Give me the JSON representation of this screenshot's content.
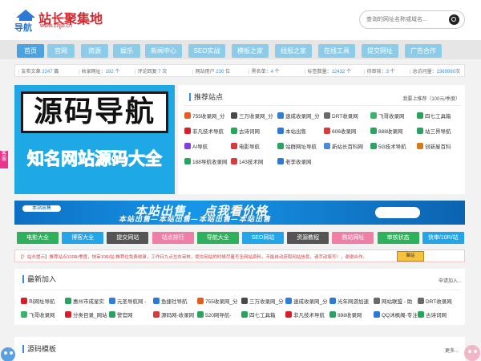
{
  "header": {
    "logo_main": "站长聚集地",
    "logo_nav": "导航",
    "logo_url": "www.zzjjd.cn",
    "search_placeholder": "查询的网址名称或域名..."
  },
  "nav": [
    "首页",
    "官网",
    "资源",
    "娱乐",
    "新闻中心",
    "SEO实战",
    "模板之家",
    "线报之家",
    "在线工具",
    "提交网址",
    "广告合作"
  ],
  "stats": [
    {
      "label": "友布文章",
      "value": "2247",
      "unit": "篇"
    },
    {
      "label": "收录网址：",
      "value": "192",
      "unit": "个"
    },
    {
      "label": "评论回复",
      "value": "7",
      "unit": "次"
    },
    {
      "label": "网站用户",
      "value": "230",
      "unit": "位"
    },
    {
      "label": "黑名单：",
      "value": "4",
      "unit": "个"
    },
    {
      "label": "标签数量：",
      "value": "12432",
      "unit": "个"
    },
    {
      "label": "待审核：",
      "value": "3",
      "unit": "个"
    },
    {
      "label": "总访问量：",
      "value": "2369990",
      "unit": "次"
    }
  ],
  "banner": {
    "title": "源码导航",
    "subtitle": "知名网站源码大全"
  },
  "recommend": {
    "title": "推荐站点",
    "more": "我要上推荐（100元/季度）",
    "sites": [
      {
        "name": "755收录网_分",
        "color": "#e85b1c"
      },
      {
        "name": "三万收录网_分",
        "color": "#4a4a4a"
      },
      {
        "name": "速成收录网_分",
        "color": "#2f7fd6"
      },
      {
        "name": "DRT收录网",
        "color": "#6a6a6a"
      },
      {
        "name": "飞哥收录网",
        "color": "#3bb36a"
      },
      {
        "name": "四七工具箱",
        "color": "#29a35a"
      },
      {
        "name": "非凡技术导航",
        "color": "#d61f26"
      },
      {
        "name": "古诗词网",
        "color": "#26a65b"
      },
      {
        "name": "本站出售",
        "color": "#2b7ad6"
      },
      {
        "name": "606收录网",
        "color": "#d63c3c"
      },
      {
        "name": "888收录网",
        "color": "#2aa361"
      },
      {
        "name": "站三界导航",
        "color": "#2aa361"
      },
      {
        "name": "AI导航",
        "color": "#8a3ad6"
      },
      {
        "name": "电影导航",
        "color": "#d63c3c"
      },
      {
        "name": "站群网址导航",
        "color": "#2aa361"
      },
      {
        "name": "新站长百科网",
        "color": "#4a8ad6"
      },
      {
        "name": "5G技术导航",
        "color": "#2aa361"
      },
      {
        "name": "创新屋百科",
        "color": "#d67a1c"
      },
      {
        "name": "188导航收录网",
        "color": "#2aa361"
      },
      {
        "name": "143技术网",
        "color": "#d63c3c"
      },
      {
        "name": "老李收录网",
        "color": "#2b7ad6"
      }
    ]
  },
  "ad": {
    "tag": "本站出售",
    "line1": "本站出售， 点我看价格",
    "line2": "本站出售—本站出售—本站出售—本站出售"
  },
  "categories": [
    {
      "label": "电影大全",
      "color": "#2eb05c"
    },
    {
      "label": "博客大全",
      "color": "#23a5e8"
    },
    {
      "label": "提交网站",
      "color": "#555555"
    },
    {
      "label": "站点排行",
      "color": "#f07fa8"
    },
    {
      "label": "导航大全",
      "color": "#2eb05c"
    },
    {
      "label": "SEO网站",
      "color": "#23a5e8"
    },
    {
      "label": "资源教程",
      "color": "#555555"
    },
    {
      "label": "购站网址",
      "color": "#f07fa8"
    },
    {
      "label": "审核状态",
      "color": "#2eb05c"
    },
    {
      "label": "快审/10R/站",
      "color": "#23a5e8"
    }
  ],
  "notice": {
    "text": "【！站长提示】推荐站点100R/季度，快审10R/站 推荐位免费收录，工作日九点左右审核，提交网站的时候尽量写全网站资料，不能自动获取网站信息，请手动填写！，谢谢合作。",
    "logo": "聚站"
  },
  "latest": {
    "title": "最新加入",
    "more": "申请加入...",
    "sites": [
      {
        "name": "叫网址导航",
        "color": "#d61f26"
      },
      {
        "name": "惠州市成星实",
        "color": "#2aa361"
      },
      {
        "name": "元圣导航网 -",
        "color": "#2f7fd6"
      },
      {
        "name": "鱼捷社导航",
        "color": "#2b7ad6"
      },
      {
        "name": "755收录网_分",
        "color": "#e85b1c"
      },
      {
        "name": "三万收录网_分",
        "color": "#4a4a4a"
      },
      {
        "name": "速成收录网_分",
        "color": "#2f7fd6"
      },
      {
        "name": "光年网游加速",
        "color": "#2b7ad6"
      },
      {
        "name": "网站联盟 - 助",
        "color": "#6a6a6a"
      },
      {
        "name": "DRT收录网",
        "color": "#6a6a6a"
      },
      {
        "name": "飞哥收录网",
        "color": "#3bb36a"
      },
      {
        "name": "分类目录_网站",
        "color": "#d61f26"
      },
      {
        "name": "警官网",
        "color": "#2aa361"
      },
      {
        "name": "源码网-收录网",
        "color": "#d63c3c"
      },
      {
        "name": "520网导航-",
        "color": "#2aa361"
      },
      {
        "name": "四七工具箱",
        "color": "#29a35a"
      },
      {
        "name": "非凡技术导航",
        "color": "#d61f26"
      },
      {
        "name": "998收录网",
        "color": "#2aa361"
      },
      {
        "name": "QQ沐枫阁-专注",
        "color": "#2b7ad6"
      },
      {
        "name": "古诗词网",
        "color": "#26a65b"
      }
    ]
  },
  "source": {
    "title": "源码模板",
    "more": "更多..."
  },
  "float_tab": "客服"
}
